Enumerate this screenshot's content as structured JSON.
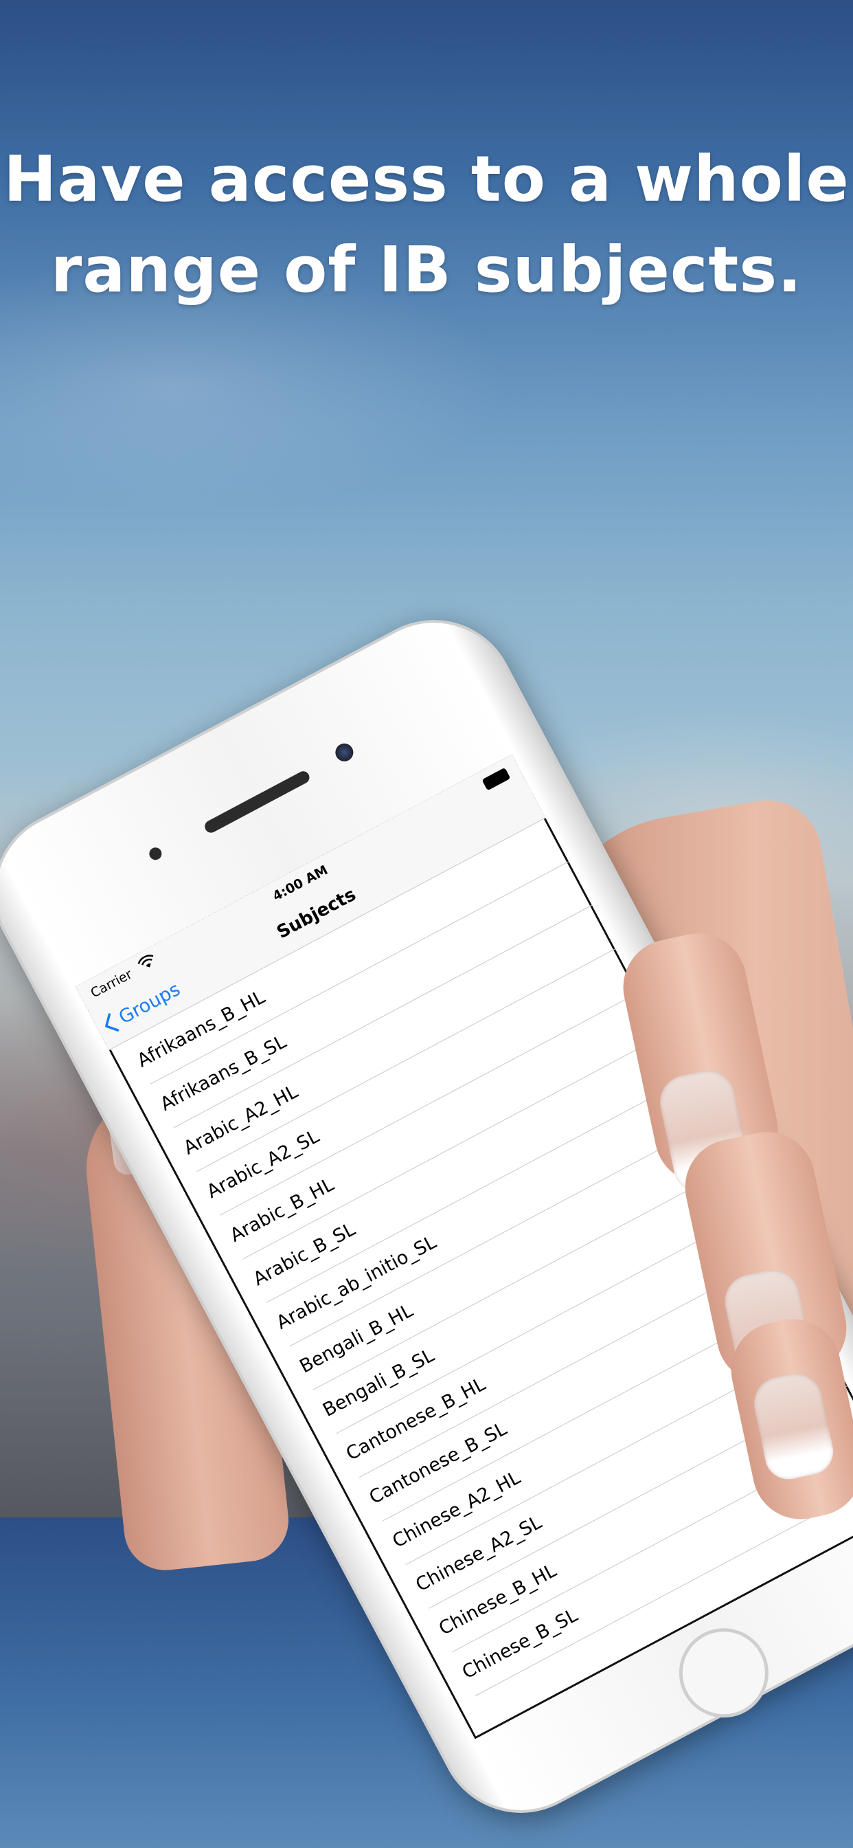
{
  "headline": {
    "line1": "Have access to a whole",
    "line2": "range of IB subjects."
  },
  "status_bar": {
    "carrier": "Carrier",
    "time": "4:00 AM"
  },
  "nav": {
    "back_label": "Groups",
    "title": "Subjects"
  },
  "subjects": [
    "Afrikaans_B_HL",
    "Afrikaans_B_SL",
    "Arabic_A2_HL",
    "Arabic_A2_SL",
    "Arabic_B_HL",
    "Arabic_B_SL",
    "Arabic_ab_initio_SL",
    "Bengali_B_HL",
    "Bengali_B_SL",
    "Cantonese_B_HL",
    "Cantonese_B_SL",
    "Chinese_A2_HL",
    "Chinese_A2_SL",
    "Chinese_B_HL",
    "Chinese_B_SL"
  ],
  "colors": {
    "accent": "#1a7cf5",
    "headline_text": "#ffffff"
  }
}
